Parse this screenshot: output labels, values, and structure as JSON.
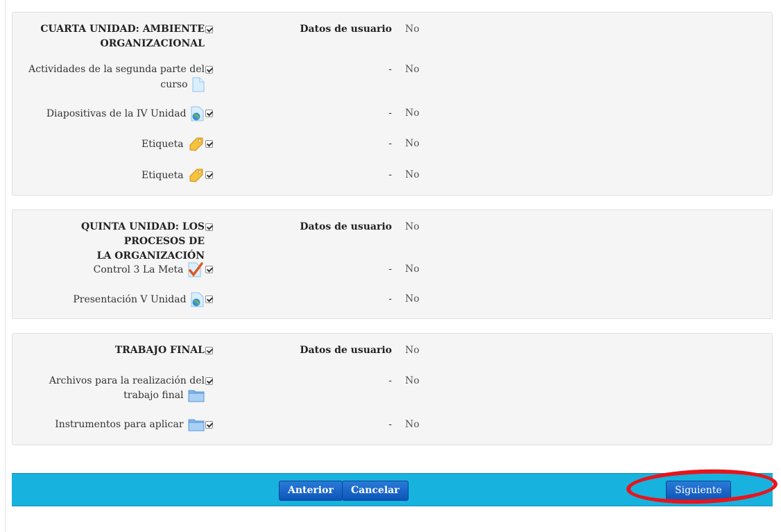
{
  "sections": [
    {
      "title_lines": [
        "CUARTA UNIDAD: AMBIENTE",
        "ORGANIZACIONAL"
      ],
      "user_data_label": "Datos de usuario",
      "user_data_value": "No",
      "items": [
        {
          "label_lines": [
            "Actividades de la segunda parte del",
            "curso"
          ],
          "icon": "file-icon",
          "dash": "-",
          "value": "No"
        },
        {
          "label_lines": [
            "Diapositivas de la IV Unidad"
          ],
          "icon": "url-globe-icon",
          "dash": "-",
          "value": "No"
        },
        {
          "label_lines": [
            "Etiqueta"
          ],
          "icon": "label-tag-icon",
          "dash": "-",
          "value": "No"
        },
        {
          "label_lines": [
            "Etiqueta"
          ],
          "icon": "label-tag-icon",
          "dash": "-",
          "value": "No"
        }
      ]
    },
    {
      "title_lines": [
        "QUINTA UNIDAD: LOS PROCESOS DE",
        "LA ORGANIZACIÓN"
      ],
      "user_data_label": "Datos de usuario",
      "user_data_value": "No",
      "items": [
        {
          "label_lines": [
            "Control 3 La Meta"
          ],
          "icon": "assignment-check-icon",
          "dash": "-",
          "value": "No"
        },
        {
          "label_lines": [
            "Presentación V Unidad"
          ],
          "icon": "url-globe-icon",
          "dash": "-",
          "value": "No"
        }
      ]
    },
    {
      "title_lines": [
        "TRABAJO FINAL"
      ],
      "user_data_label": "Datos de usuario",
      "user_data_value": "No",
      "items": [
        {
          "label_lines": [
            "Archivos para la realización del",
            "trabajo final"
          ],
          "icon": "folder-icon",
          "dash": "-",
          "value": "No"
        },
        {
          "label_lines": [
            "Instrumentos para aplicar"
          ],
          "icon": "folder-icon",
          "dash": "-",
          "value": "No"
        }
      ]
    }
  ],
  "buttons": {
    "previous": "Anterior",
    "cancel": "Cancelar",
    "next": "Siguiente"
  },
  "colors": {
    "footer_bar": "#17b2de",
    "button": "#1565c0",
    "highlight_ring": "#e8141c"
  }
}
